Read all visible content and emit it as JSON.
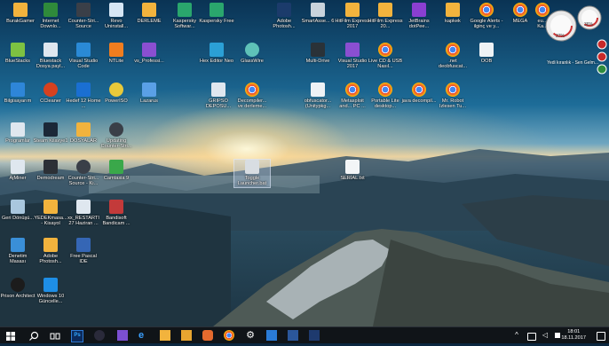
{
  "desktop": {
    "icons": [
      {
        "label": "BurakGamer",
        "color": "#f2b33d",
        "kind": "folder"
      },
      {
        "label": "Internet Downlo...",
        "color": "#2f8a3b",
        "kind": "app"
      },
      {
        "label": "Counter-Stri... Source",
        "color": "#3a3f48",
        "kind": "app"
      },
      {
        "label": "Revo Uninstall...",
        "color": "#d6e6f5",
        "kind": "app"
      },
      {
        "label": "DERLEME",
        "color": "#f2b33d",
        "kind": "folder"
      },
      {
        "label": "Kaspersky Softwar...",
        "color": "#2aa66d",
        "kind": "app"
      },
      {
        "label": "Kaspersky Free",
        "color": "#2aa66d",
        "kind": "app"
      },
      {
        "label": "Adobe Photosh...",
        "color": "#1b3b6b",
        "kind": "app"
      },
      {
        "label": "SmartAsse... 6",
        "color": "#c9d3dc",
        "kind": "file"
      },
      {
        "label": "HitFilm Express 2017",
        "color": "#f2b33d",
        "kind": "folder"
      },
      {
        "label": "HitFilm Express 20...",
        "color": "#f2b33d",
        "kind": "folder"
      },
      {
        "label": "JetBrains dotPee...",
        "color": "#8a3fd1",
        "kind": "app"
      },
      {
        "label": "kapkek",
        "color": "#f2b33d",
        "kind": "folder"
      },
      {
        "label": "Google Alerts - ilginç ve y...",
        "color": "#e5e5e5",
        "kind": "chrome"
      },
      {
        "label": "MEGA",
        "color": "#e5e5e5",
        "kind": "chrome"
      },
      {
        "label": "eu... Ka...",
        "color": "#e5e5e5",
        "kind": "chrome"
      },
      {
        "label": "BlueStacks",
        "color": "#7dc242",
        "kind": "app"
      },
      {
        "label": "Bluestack Dosya payl...",
        "color": "#dfe7ef",
        "kind": "file"
      },
      {
        "label": "Visual Studio Code",
        "color": "#2a8ad6",
        "kind": "app"
      },
      {
        "label": "NTLite",
        "color": "#f07d1f",
        "kind": "app"
      },
      {
        "label": "vs_Professi...",
        "color": "#8a4fd1",
        "kind": "app"
      },
      {
        "label": "Hex Editor Neo",
        "color": "#2ba0d6",
        "kind": "app"
      },
      {
        "label": "GlassWire",
        "color": "#5ec2b8",
        "kind": "app"
      },
      {
        "label": "Multi-Drive",
        "color": "#2a3238",
        "kind": "app"
      },
      {
        "label": "Visual Studio 2017",
        "color": "#8a4fd1",
        "kind": "app"
      },
      {
        "label": "Live CD & USB Nasıl...",
        "color": "#e5e5e5",
        "kind": "chrome"
      },
      {
        "label": ".net deobfuscat...",
        "color": "#e5e5e5",
        "kind": "chrome"
      },
      {
        "label": "OOB",
        "color": "#eef2f5",
        "kind": "file"
      },
      {
        "label": "Bilgisayarım",
        "color": "#2e86d8",
        "kind": "app"
      },
      {
        "label": "CCleaner",
        "color": "#d6411f",
        "kind": "app"
      },
      {
        "label": "Hedef 12 Home ...",
        "color": "#1a6fd2",
        "kind": "app"
      },
      {
        "label": "PowerISO",
        "color": "#e8c93a",
        "kind": "app"
      },
      {
        "label": "Lazarus",
        "color": "#5aa0e6",
        "kind": "app"
      },
      {
        "label": "GRIPSO DEPOSU...",
        "color": "#dfe7ef",
        "kind": "file"
      },
      {
        "label": "Decompiler... ve derleme...",
        "color": "#e5e5e5",
        "kind": "chrome"
      },
      {
        "label": "obfuscator... (Unitypkg...",
        "color": "#eef2f5",
        "kind": "file"
      },
      {
        "label": "Metasploit and... PC ...",
        "color": "#e5e5e5",
        "kind": "chrome"
      },
      {
        "label": "Portable Lite desktop...",
        "color": "#e5e5e5",
        "kind": "chrome"
      },
      {
        "label": "java decompil...",
        "color": "#e5e5e5",
        "kind": "chrome"
      },
      {
        "label": "Mr. Robot Izlesen Tu...",
        "color": "#e5e5e5",
        "kind": "chrome"
      },
      {
        "label": "Programlar",
        "color": "#dfe7ef",
        "kind": "file"
      },
      {
        "label": "Steam Kilavye1",
        "color": "#1b2838",
        "kind": "app"
      },
      {
        "label": "DOSYALAR",
        "color": "#f2b33d",
        "kind": "folder"
      },
      {
        "label": "Updating Counter-Stri...",
        "color": "#3a3f48",
        "kind": "app"
      },
      {
        "label": "Toggle Launcher.bat",
        "color": "#d8dde2",
        "kind": "file"
      },
      {
        "label": "SERİAL.txt",
        "color": "#f3f5f7",
        "kind": "file"
      },
      {
        "label": "AjMiner",
        "color": "#dfe7ef",
        "kind": "file"
      },
      {
        "label": "Demodream",
        "color": "#2c3036",
        "kind": "app"
      },
      {
        "label": "Counter-Stri... Source - Kı...",
        "color": "#3a3f48",
        "kind": "app"
      },
      {
        "label": "Camtasia 9",
        "color": "#3aa84a",
        "kind": "app"
      },
      {
        "label": "Geri Dönüşü...",
        "color": "#a9c7de",
        "kind": "app"
      },
      {
        "label": "YEDEKmasa... - Kisayol",
        "color": "#f2b33d",
        "kind": "folder"
      },
      {
        "label": "xx_RESTARTI 27 Haziran ...",
        "color": "#dfe7ef",
        "kind": "file"
      },
      {
        "label": "Bandisoft Bandicam ...",
        "color": "#c33a3a",
        "kind": "app"
      },
      {
        "label": "Denetim Masası",
        "color": "#3a8fd8",
        "kind": "app"
      },
      {
        "label": "Adobe Photosh...",
        "color": "#f2b33d",
        "kind": "folder"
      },
      {
        "label": "Free Pascal IDE",
        "color": "#3566b5",
        "kind": "app"
      },
      {
        "label": "Prison Architect",
        "color": "#1c1c1c",
        "kind": "app"
      },
      {
        "label": "Windows 10 Güncelle...",
        "color": "#1e8ee6",
        "kind": "app"
      }
    ]
  },
  "gadget": {
    "label": "Yedi kıranlık - Sen Gelm...",
    "cpu": "37%",
    "mem": "36%"
  },
  "taskbar": {
    "time": "18:01",
    "date": "18.11.2017",
    "items": [
      "start",
      "search",
      "task-view",
      "photoshop",
      "vs",
      "vs-studio",
      "edge",
      "explorer",
      "folder",
      "java",
      "chrome",
      "settings",
      "store",
      "word",
      "powershell"
    ]
  }
}
